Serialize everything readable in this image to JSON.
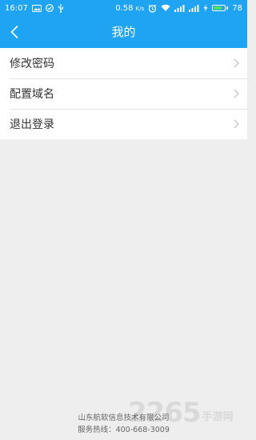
{
  "status_bar": {
    "time": "16:07",
    "speed": "0.58",
    "speed_unit": "K/s",
    "battery": "78",
    "battery_level": 0.78,
    "icons": [
      "image-icon",
      "check-circle-icon",
      "usb-icon",
      "alarm-icon",
      "wifi-icon",
      "signal-icon",
      "signal-icon",
      "charging-icon"
    ]
  },
  "nav": {
    "title": "我的",
    "back_icon": "chevron-left-icon"
  },
  "menu": {
    "items": [
      {
        "label": "修改密码"
      },
      {
        "label": "配置域名"
      },
      {
        "label": "退出登录"
      }
    ]
  },
  "footer": {
    "company": "山东航软信息技术有限公司",
    "hotline": "服务热线：400-668-3009"
  },
  "watermark": {
    "number": "2265",
    "text": "手游网"
  },
  "colors": {
    "accent": "#1ea4f2",
    "background": "#eeeeee"
  }
}
